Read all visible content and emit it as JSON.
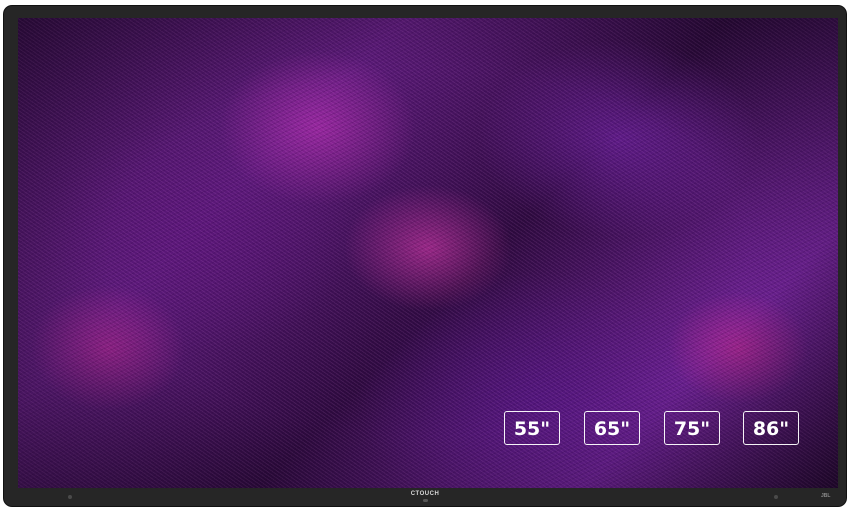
{
  "display": {
    "brand": "CTOUCH",
    "audio_brand": "JBL"
  },
  "sizes": [
    "55\"",
    "65\"",
    "75\"",
    "86\""
  ]
}
